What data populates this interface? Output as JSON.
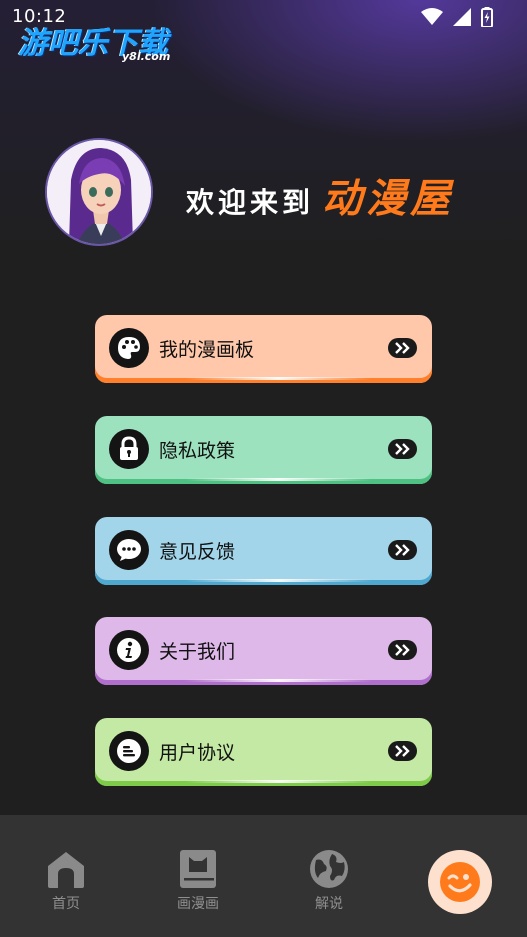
{
  "status_bar": {
    "time": "10:12"
  },
  "watermark": {
    "main": "游吧乐下载",
    "sub": "y8l.com"
  },
  "welcome": {
    "prefix": "欢迎来到",
    "name": "动漫屋"
  },
  "menu": [
    {
      "label": "我的漫画板",
      "icon": "palette-icon",
      "bg": "#ffc8aa",
      "edge": "#ff7f2a"
    },
    {
      "label": "隐私政策",
      "icon": "lock-icon",
      "bg": "#9ce2bf",
      "edge": "#4fc182"
    },
    {
      "label": "意见反馈",
      "icon": "chat-dots-icon",
      "bg": "#a3d5ea",
      "edge": "#4ea8cf"
    },
    {
      "label": "关于我们",
      "icon": "info-icon",
      "bg": "#ddb8e8",
      "edge": "#b16fcd"
    },
    {
      "label": "用户协议",
      "icon": "document-lines-icon",
      "bg": "#c4e9a4",
      "edge": "#7ecb4a"
    }
  ],
  "bottom_nav": {
    "items": [
      {
        "label": "首页",
        "icon": "home-icon"
      },
      {
        "label": "画漫画",
        "icon": "sketchbook-icon"
      },
      {
        "label": "解说",
        "icon": "globe-icon"
      },
      {
        "label": "",
        "icon": "wink-face-icon"
      }
    ]
  },
  "colors": {
    "accent": "#ff7a1a",
    "background": "#1f1f1f",
    "nav_bg": "#333333"
  }
}
